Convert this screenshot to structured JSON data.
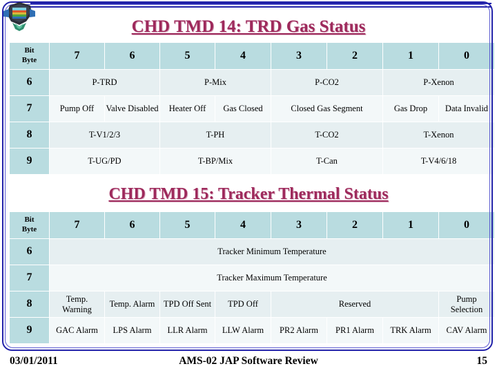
{
  "slide": {
    "logo_alt": "ams-detector-logo"
  },
  "section1": {
    "title": "CHD TMD 14: TRD Gas Status",
    "corner_label_top": "Bit",
    "corner_label_bottom": "Byte",
    "bit_headers": [
      "7",
      "6",
      "5",
      "4",
      "3",
      "2",
      "1",
      "0"
    ],
    "rows": [
      {
        "byte": "6",
        "cells": [
          {
            "text": "P-TRD",
            "span": 2
          },
          {
            "text": "P-Mix",
            "span": 2
          },
          {
            "text": "P-CO2",
            "span": 2
          },
          {
            "text": "P-Xenon",
            "span": 2
          }
        ]
      },
      {
        "byte": "7",
        "cells": [
          {
            "text": "Pump Off",
            "span": 1
          },
          {
            "text": "Valve Disabled",
            "span": 1
          },
          {
            "text": "Heater Off",
            "span": 1
          },
          {
            "text": "Gas Closed",
            "span": 1
          },
          {
            "text": "Closed Gas Segment",
            "span": 2
          },
          {
            "text": "Gas Drop",
            "span": 1
          },
          {
            "text": "Data Invalid",
            "span": 1
          }
        ]
      },
      {
        "byte": "8",
        "cells": [
          {
            "text": "T-V1/2/3",
            "span": 2
          },
          {
            "text": "T-PH",
            "span": 2
          },
          {
            "text": "T-CO2",
            "span": 2
          },
          {
            "text": "T-Xenon",
            "span": 2
          }
        ]
      },
      {
        "byte": "9",
        "cells": [
          {
            "text": "T-UG/PD",
            "span": 2
          },
          {
            "text": "T-BP/Mix",
            "span": 2
          },
          {
            "text": "T-Can",
            "span": 2
          },
          {
            "text": "T-V4/6/18",
            "span": 2
          }
        ]
      }
    ]
  },
  "section2": {
    "title": "CHD TMD 15: Tracker Thermal Status",
    "corner_label_top": "Bit",
    "corner_label_bottom": "Byte",
    "bit_headers": [
      "7",
      "6",
      "5",
      "4",
      "3",
      "2",
      "1",
      "0"
    ],
    "rows": [
      {
        "byte": "6",
        "cells": [
          {
            "text": "Tracker Minimum Temperature",
            "span": 8
          }
        ]
      },
      {
        "byte": "7",
        "cells": [
          {
            "text": "Tracker Maximum Temperature",
            "span": 8
          }
        ]
      },
      {
        "byte": "8",
        "cells": [
          {
            "text": "Temp. Warning",
            "span": 1
          },
          {
            "text": "Temp. Alarm",
            "span": 1
          },
          {
            "text": "TPD Off Sent",
            "span": 1
          },
          {
            "text": "TPD Off",
            "span": 1
          },
          {
            "text": "Reserved",
            "span": 3
          },
          {
            "text": "Pump Selection",
            "span": 1
          }
        ]
      },
      {
        "byte": "9",
        "cells": [
          {
            "text": "GAC Alarm",
            "span": 1
          },
          {
            "text": "LPS Alarm",
            "span": 1
          },
          {
            "text": "LLR Alarm",
            "span": 1
          },
          {
            "text": "LLW Alarm",
            "span": 1
          },
          {
            "text": "PR2 Alarm",
            "span": 1
          },
          {
            "text": "PR1 Alarm",
            "span": 1
          },
          {
            "text": "TRK Alarm",
            "span": 1
          },
          {
            "text": "CAV Alarm",
            "span": 1
          }
        ]
      }
    ]
  },
  "footer": {
    "date": "03/01/2011",
    "title": "AMS-02 JAP Software Review",
    "page": "15"
  },
  "colors": {
    "title": "#9e2a5c",
    "frame": "#2222aa",
    "header_cell": "#b9dce0",
    "data_cell_a": "#e6eff1",
    "data_cell_b": "#f3f8f9"
  }
}
